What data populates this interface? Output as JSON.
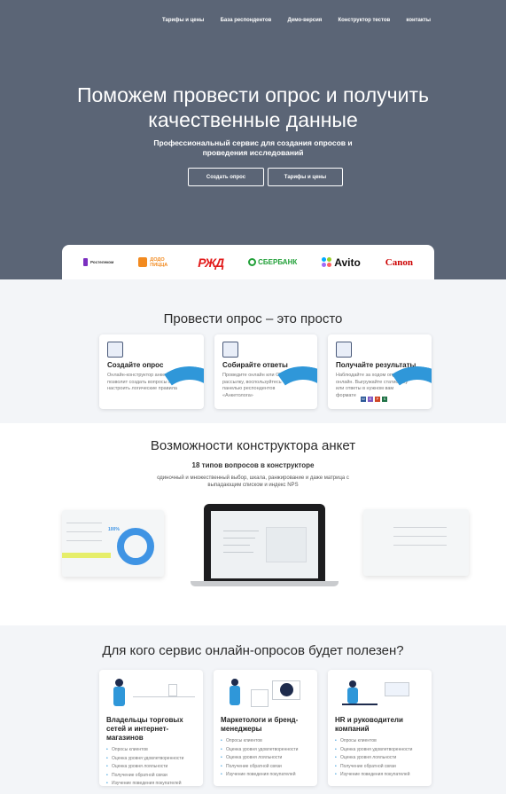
{
  "nav": [
    "Тарифы и цены",
    "База респондентов",
    "Демо-версия",
    "Конструктор тестов",
    "контакты"
  ],
  "hero": {
    "title_line1": "Поможем провести опрос и получить",
    "title_line2": "качественные данные",
    "subtitle_line1": "Профессиональный сервис для создания опросов и",
    "subtitle_line2": "проведения исследований",
    "btn_create": "Создать опрос",
    "btn_tariffs": "Тарифы и цены"
  },
  "logos": [
    "Ростелеком",
    "ДОДО ПИЦЦА",
    "РЖД",
    "СБЕРБАНК",
    "Avito",
    "Canon"
  ],
  "simple": {
    "title": "Провести опрос – это просто",
    "cards": [
      {
        "title": "Создайте опрос",
        "desc": "Онлайн-конструктор анкет позволит создать вопросы и настроить логические правила"
      },
      {
        "title": "Собирайте ответы",
        "desc": "Проведите онлайн или СМС-рассылку, воспользуйтесь панелью респондентов «Анкетолога»"
      },
      {
        "title": "Получайте результаты",
        "desc": "Наблюдайте за ходом опроса онлайн. Выгружайте статистику или ответы в нужном вам формате"
      }
    ],
    "formats": [
      "W",
      "E",
      "P",
      "S"
    ]
  },
  "features": {
    "title": "Возможности конструктора анкет",
    "subtitle": "18 типов вопросов в конструкторе",
    "desc_line1": "одиночный и множественный выбор, шкала, ранжирование и даже матрица с",
    "desc_line2": "выпадающим списком и индекс NPS",
    "percent": "100%"
  },
  "audience": {
    "title": "Для кого сервис онлайн-опросов будет полезен?",
    "cards": [
      {
        "title": "Владельцы торговых сетей и интернет-магазинов",
        "items": [
          "Опросы клиентов",
          "Оценка уровня удовлетворенности",
          "Оценка уровня лояльности",
          "Получение обратной связи",
          "Изучение поведения покупателей"
        ]
      },
      {
        "title": "Маркетологи и бренд-менеджеры",
        "items": [
          "Опросы клиентов",
          "Оценка уровня удовлетворенности",
          "Оценка уровня лояльности",
          "Получение обратной связи",
          "Изучение поведения покупателей"
        ]
      },
      {
        "title": "HR и руководители компаний",
        "items": [
          "Опросы клиентов",
          "Оценка уровня удовлетворенности",
          "Оценка уровня лояльности",
          "Получение обратной связи",
          "Изучение поведения покупателей"
        ]
      }
    ]
  },
  "colors": {
    "hero": "#5b6576",
    "accent": "#2f97d9",
    "section": "#f3f5f8"
  }
}
